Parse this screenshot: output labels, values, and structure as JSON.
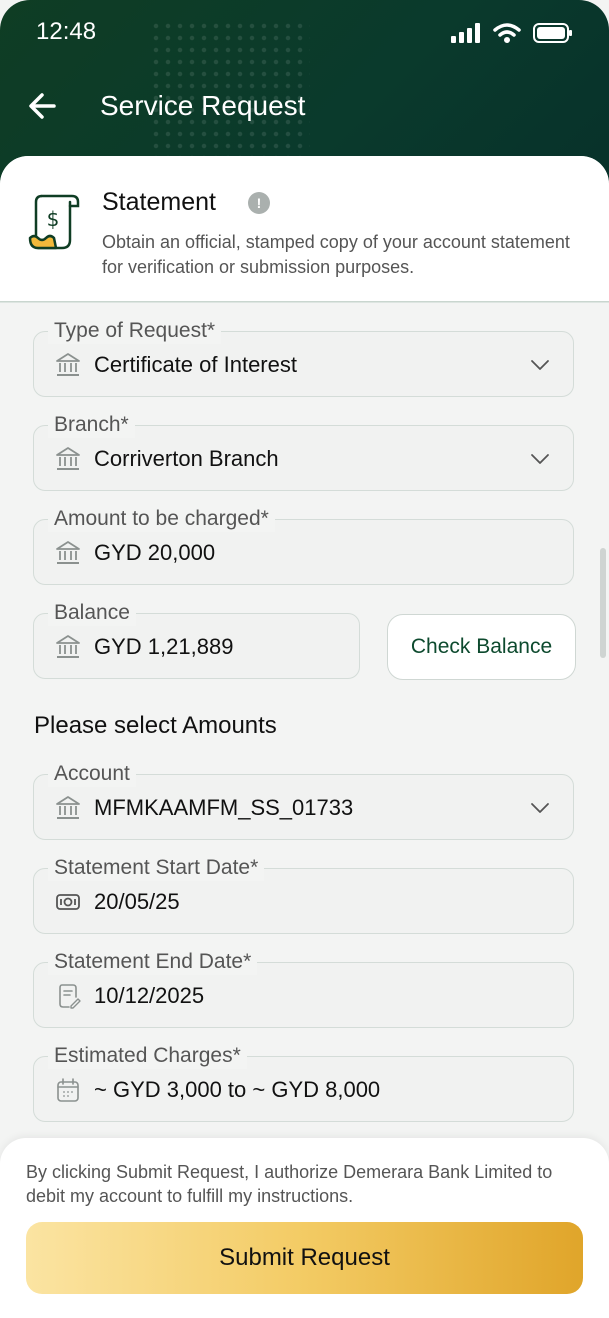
{
  "status_bar": {
    "time": "12:48"
  },
  "app_bar": {
    "title": "Service Request"
  },
  "service": {
    "title": "Statement",
    "info_symbol": "!",
    "description": "Obtain an official, stamped copy of your account statement for verification or submission purposes."
  },
  "form": {
    "type_of_request": {
      "label": "Type of Request*",
      "value": "Certificate of Interest"
    },
    "branch": {
      "label": "Branch*",
      "value": "Corriverton Branch"
    },
    "amount": {
      "label": "Amount to be charged*",
      "value": "GYD 20,000"
    },
    "balance": {
      "label": "Balance",
      "value": "GYD 1,21,889"
    },
    "check_balance_label": "Check Balance",
    "section_heading": "Please select Amounts",
    "account": {
      "label": "Account",
      "value": "MFMKAAMFM_SS_01733"
    },
    "start_date": {
      "label": "Statement Start Date*",
      "value": "20/05/25"
    },
    "end_date": {
      "label": "Statement End Date*",
      "value": "10/12/2025"
    },
    "charges": {
      "label": "Estimated Charges*",
      "value": "~ GYD 3,000 to ~ GYD 8,000"
    }
  },
  "footer": {
    "disclaimer": "By clicking Submit Request, I authorize Demerara Bank Limited to debit my account to fulfill my instructions.",
    "submit_label": "Submit Request"
  },
  "icons": {
    "back": "arrow-left-icon",
    "statement": "receipt-dollar-icon",
    "field": "bank-icon",
    "chevron": "chevron-down-icon",
    "cash": "cash-icon",
    "document": "document-edit-icon",
    "calendar": "calendar-icon"
  },
  "colors": {
    "header_green": "#0a3a2c",
    "accent_gold": "#e0a52a",
    "check_balance_text": "#0d4a2e"
  }
}
